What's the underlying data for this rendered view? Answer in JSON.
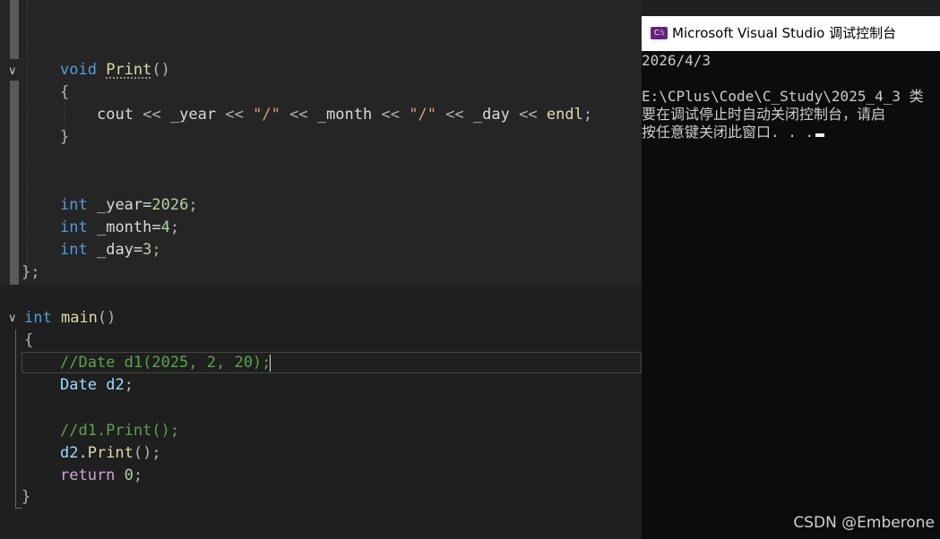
{
  "editor": {
    "lines": {
      "print_void": "void",
      "print_name": "Print",
      "print_parens": "()",
      "open_brace_1": "{",
      "cout": "cout",
      "op1": "<<",
      "year_var": "_year",
      "op2": "<<",
      "slash1": "\"/\"",
      "op3": "<<",
      "month_var": "_month",
      "op4": "<<",
      "slash2": "\"/\"",
      "op5": "<<",
      "day_var": "_day",
      "op6": "<<",
      "endl": "endl",
      "semi1": ";",
      "close_brace_1": "}",
      "int_kw_1": "int",
      "year_decl": "_year=",
      "year_val": "2026",
      "semi_y": ";",
      "int_kw_2": "int",
      "month_decl": "_month=",
      "month_val": "4",
      "semi_m": ";",
      "int_kw_3": "int",
      "day_decl": "_day=",
      "day_val": "3",
      "semi_d": ";",
      "class_end": "};",
      "main_int": "int",
      "main_name": "main",
      "main_parens": "()",
      "open_brace_2": "{",
      "comment_1": "//Date d1(2025, 2, 20);",
      "date_type": "Date",
      "d2_decl": "d2",
      "semi_d2": ";",
      "comment_2": "//d1.Print();",
      "d2_call_obj": "d2",
      "d2_call_rest": ".Print",
      "d2_call_parens": "();",
      "return_kw": "return",
      "return_val": "0",
      "semi_ret": ";",
      "close_brace_2": "}"
    }
  },
  "console": {
    "title": "Microsoft Visual Studio 调试控制台",
    "icon_label": "C:\\",
    "lines": [
      "2026/4/3",
      "",
      "E:\\CPlus\\Code\\C_Study\\2025_4_3 类",
      "要在调试停止时自动关闭控制台，请启",
      "按任意键关闭此窗口. . ."
    ]
  },
  "watermark": "CSDN @Emberone",
  "colors": {
    "keyword": "#569cd6",
    "function": "#dcdcaa",
    "number": "#b5cea8",
    "string": "#d69d85",
    "comment": "#57a64a",
    "type": "#9cdcfe",
    "control": "#d8a0df",
    "console_bg": "#0c0c0c",
    "editor_bg": "#1f1f1f"
  }
}
